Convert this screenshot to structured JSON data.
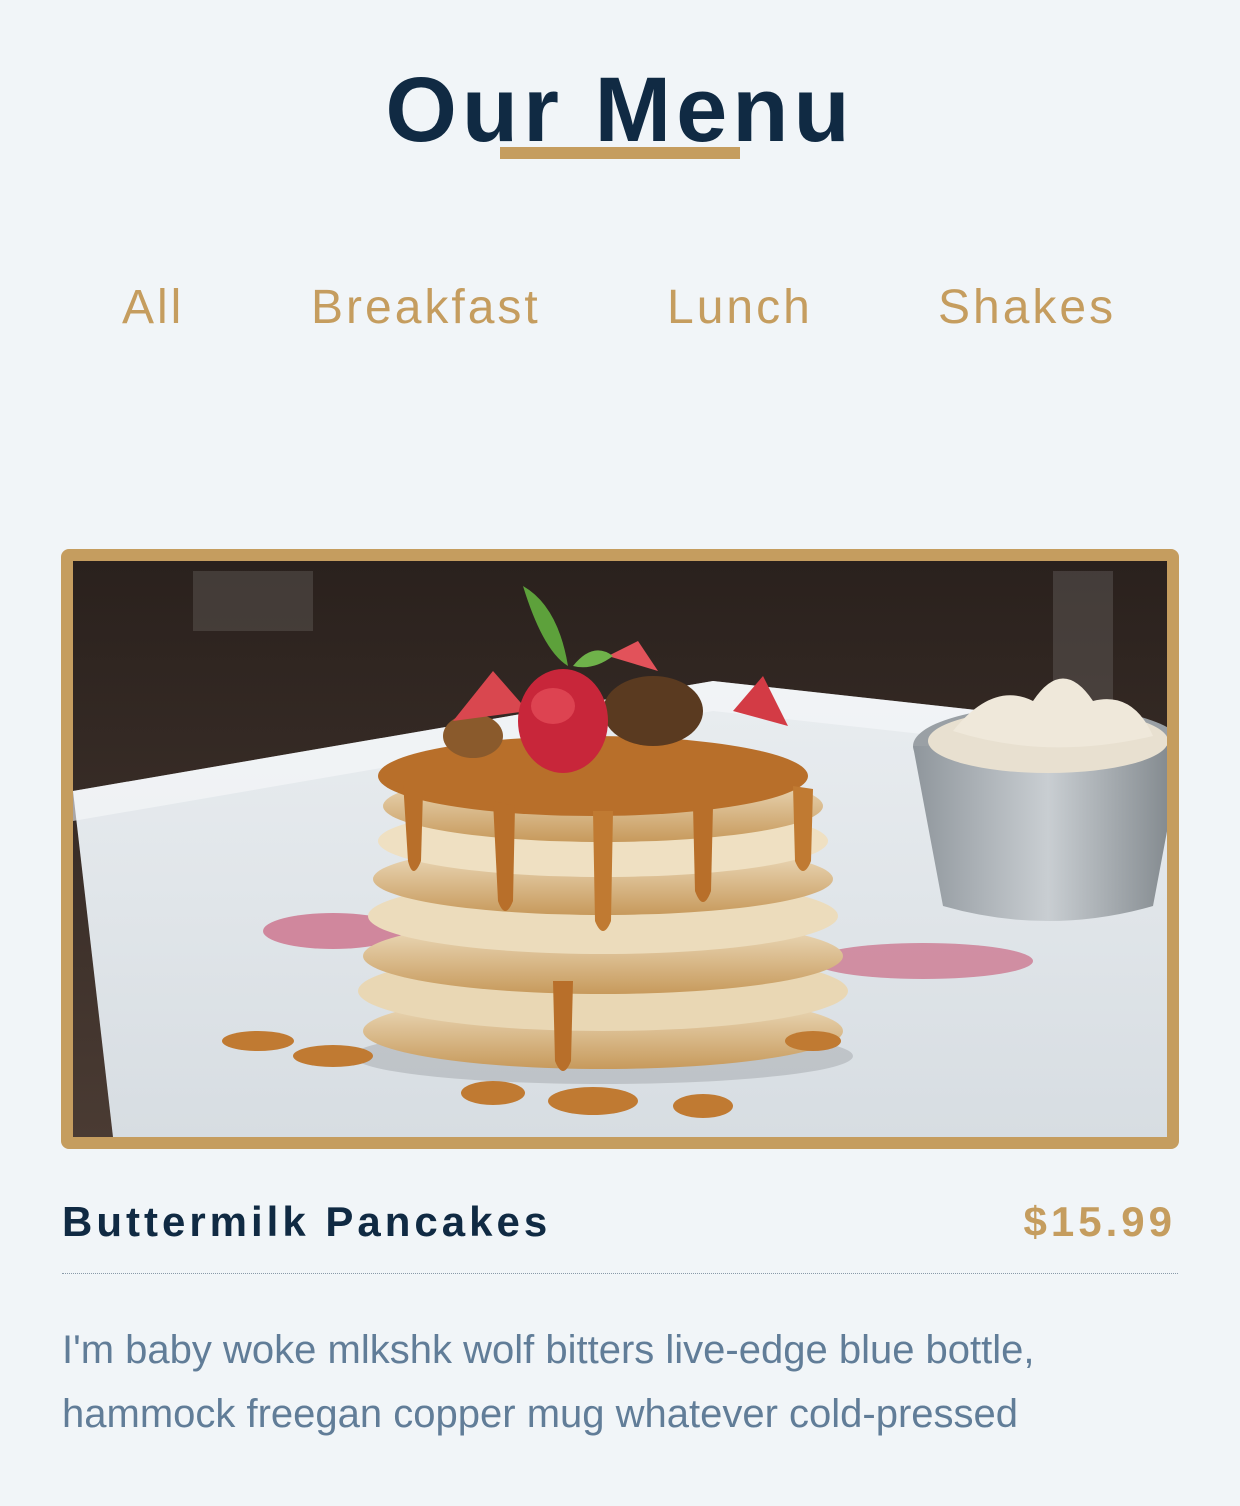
{
  "page": {
    "title": "Our Menu"
  },
  "filters": [
    {
      "label": "All"
    },
    {
      "label": "Breakfast"
    },
    {
      "label": "Lunch"
    },
    {
      "label": "Shakes"
    }
  ],
  "menu_item": {
    "name": "Buttermilk Pancakes",
    "price": "$15.99",
    "description": "I'm baby woke mlkshk wolf bitters live-edge blue bottle, hammock freegan copper mug whatever cold-pressed"
  },
  "colors": {
    "background": "#f1f5f8",
    "title": "#102a43",
    "accent_gold": "#c59d5f",
    "description_text": "#617d98"
  }
}
